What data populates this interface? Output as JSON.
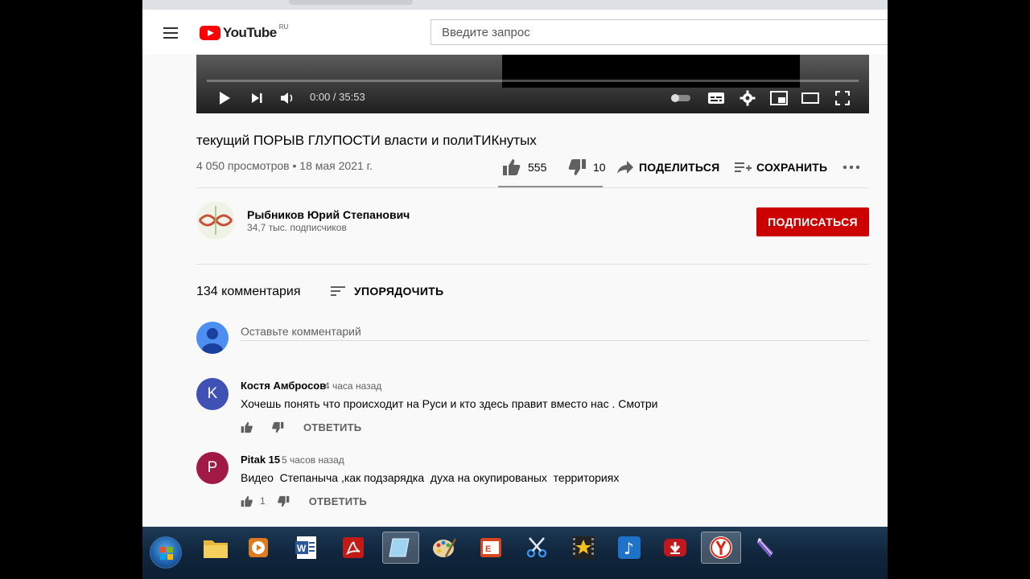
{
  "masthead": {
    "logo_text": "YouTube",
    "logo_region": "RU",
    "search_placeholder": "Введите запрос"
  },
  "player": {
    "time": "0:00 / 35:53",
    "progress_fraction": 0
  },
  "video": {
    "title": "текущий ПОРЫВ ГЛУПОСТИ власти и полиТИКнутых",
    "meta": "4 050 просмотров • 18 мая 2021 г.",
    "likes": "555",
    "dislikes": "10",
    "share_label": "ПОДЕЛИТЬСЯ",
    "save_label": "СОХРАНИТЬ"
  },
  "channel": {
    "name": "Рыбников Юрий Степанович",
    "subscribers": "34,7 тыс. подписчиков",
    "subscribe_label": "ПОДПИСАТЬСЯ"
  },
  "comments": {
    "count_label": "134 комментария",
    "sort_label": "УПОРЯДОЧИТЬ",
    "input_placeholder": "Оставьте комментарий",
    "items": [
      {
        "initial": "K",
        "avatar_color": "#3f51b5",
        "author": "Костя Амбросов",
        "time": "4 часа назад",
        "text": "Хочешь понять что происходит на Руси и кто здесь правит вместо нас . Смотри",
        "likes": "",
        "reply_label": "ОТВЕТИТЬ"
      },
      {
        "initial": "P",
        "avatar_color": "#a11a45",
        "author": "Pitak 15",
        "time": "5 часов назад",
        "text": "Видео  Степаныча ,как подзарядка  духа на окупированых  территориях",
        "likes": "1",
        "reply_label": "ОТВЕТИТЬ"
      }
    ]
  },
  "colors": {
    "brand_red": "#ff0000",
    "subscribe_red": "#cc0000"
  },
  "taskbar": {
    "icons": [
      "windows-start-icon",
      "file-explorer-icon",
      "media-player-icon",
      "word-icon",
      "pdf-reader-icon",
      "glass-app-icon",
      "paint-icon",
      "presentation-icon",
      "scissors-icon",
      "movie-star-icon",
      "music-icon",
      "download-icon",
      "yandex-browser-icon",
      "pen-tool-icon"
    ]
  }
}
